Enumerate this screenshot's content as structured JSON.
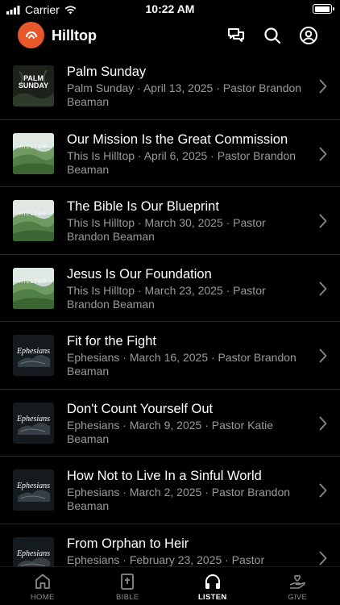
{
  "status": {
    "carrier": "Carrier",
    "time": "10:22 AM"
  },
  "header": {
    "title": "Hilltop"
  },
  "sermons": [
    {
      "title": "Palm Sunday",
      "subtitle": "Palm Sunday · April 13, 2025 · Pastor Brandon Beaman",
      "art": "palm",
      "art_text": "PALM SUNDAY"
    },
    {
      "title": "Our Mission Is the Great Commission",
      "subtitle": "This Is Hilltop · April 6, 2025 · Pastor Brandon Beaman",
      "art": "hilltop",
      "art_text": "HILLTOP"
    },
    {
      "title": "The Bible Is Our Blueprint",
      "subtitle": "This Is Hilltop · March 30, 2025 · Pastor Brandon Beaman",
      "art": "hilltop",
      "art_text": "HILLTOP"
    },
    {
      "title": "Jesus Is Our Foundation",
      "subtitle": "This Is Hilltop · March 23, 2025 · Pastor Brandon Beaman",
      "art": "hilltop",
      "art_text": "HILLTOP"
    },
    {
      "title": "Fit for the Fight",
      "subtitle": "Ephesians · March 16, 2025 · Pastor Brandon Beaman",
      "art": "ephesians",
      "art_text": "Ephesians"
    },
    {
      "title": "Don't Count Yourself Out",
      "subtitle": "Ephesians · March 9, 2025 · Pastor Katie Beaman",
      "art": "ephesians",
      "art_text": "Ephesians"
    },
    {
      "title": "How Not to Live In a Sinful World",
      "subtitle": "Ephesians · March 2, 2025 · Pastor Brandon Beaman",
      "art": "ephesians",
      "art_text": "Ephesians"
    },
    {
      "title": "From Orphan to Heir",
      "subtitle": "Ephesians · February 23, 2025 · Pastor",
      "art": "ephesians",
      "art_text": "Ephesians"
    }
  ],
  "tabs": [
    {
      "label": "HOME",
      "icon": "home-icon",
      "active": false
    },
    {
      "label": "BIBLE",
      "icon": "bible-icon",
      "active": false
    },
    {
      "label": "LISTEN",
      "icon": "headphones-icon",
      "active": true
    },
    {
      "label": "GIVE",
      "icon": "give-icon",
      "active": false
    }
  ],
  "colors": {
    "brand": "#e8572a",
    "active_tab": "#ffffff",
    "inactive_tab": "#8a8a8a",
    "subtitle": "#9a9a9a"
  }
}
